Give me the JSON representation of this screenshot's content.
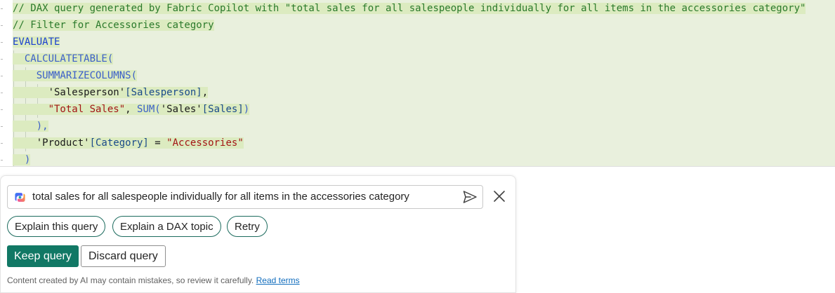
{
  "editor": {
    "lines": [
      [
        {
          "t": "// DAX query generated by Fabric Copilot with \"total sales for all salespeople individually for all items in the accessories category\"",
          "c": "comment"
        }
      ],
      [
        {
          "t": "// Filter for Accessories category",
          "c": "comment"
        }
      ],
      [
        {
          "t": "EVALUATE",
          "c": "keyword"
        }
      ],
      [
        {
          "t": "  CALCULATETABLE(",
          "c": "func"
        }
      ],
      [
        {
          "t": "    SUMMARIZECOLUMNS(",
          "c": "func"
        }
      ],
      [
        {
          "t": "      'Salesperson'",
          "c": "ident"
        },
        {
          "t": "[Salesperson]",
          "c": "column"
        },
        {
          "t": ",",
          "c": "punct"
        }
      ],
      [
        {
          "t": "      ",
          "c": "punct"
        },
        {
          "t": "\"Total Sales\"",
          "c": "string"
        },
        {
          "t": ", ",
          "c": "punct"
        },
        {
          "t": "SUM(",
          "c": "func"
        },
        {
          "t": "'Sales'",
          "c": "ident"
        },
        {
          "t": "[Sales]",
          "c": "column"
        },
        {
          "t": ")",
          "c": "blue-paren"
        }
      ],
      [
        {
          "t": "    ),",
          "c": "func"
        }
      ],
      [
        {
          "t": "    'Product'",
          "c": "ident"
        },
        {
          "t": "[Category]",
          "c": "column"
        },
        {
          "t": " = ",
          "c": "punct"
        },
        {
          "t": "\"Accessories\"",
          "c": "string"
        }
      ],
      [
        {
          "t": "  )",
          "c": "blue-paren"
        }
      ]
    ]
  },
  "copilot": {
    "prompt_value": "total sales for all salespeople individually for all items in the accessories category",
    "suggestions": [
      "Explain this query",
      "Explain a DAX topic",
      "Retry"
    ],
    "keep_label": "Keep query",
    "discard_label": "Discard query",
    "disclaimer_text": "Content created by AI may contain mistakes, so review it carefully.",
    "read_terms_label": "Read terms"
  },
  "colors": {
    "primary_button": "#117865",
    "chip_border": "#1c6b5e",
    "code_background": "#e9f0dd",
    "code_highlight": "#dcebc0"
  },
  "icons": {
    "logo": "copilot-logo-icon",
    "send": "send-icon",
    "close": "close-icon"
  }
}
